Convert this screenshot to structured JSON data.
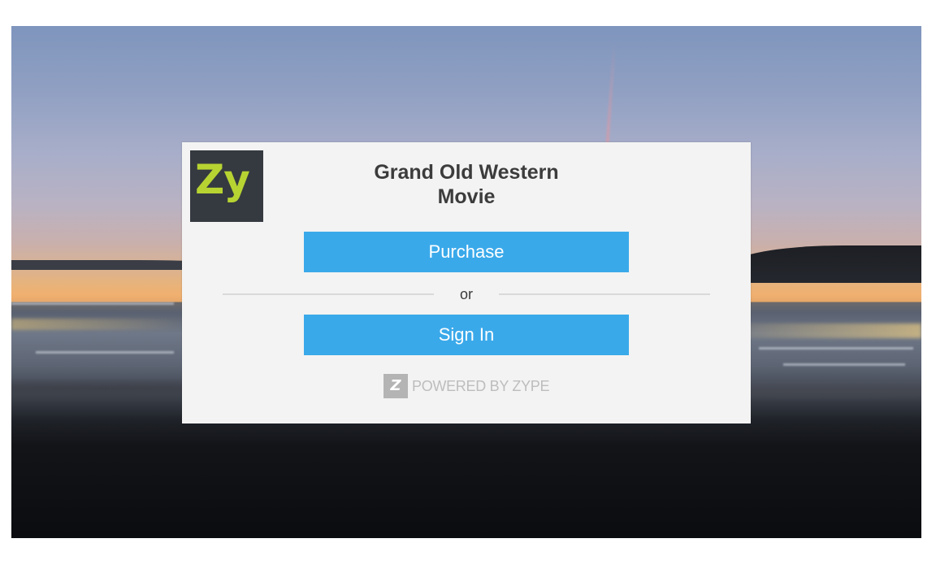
{
  "background": {
    "description_icon": "lake-sunset-background"
  },
  "modal": {
    "logo": {
      "text": "Zy",
      "bg_color": "#353a40",
      "text_color": "#b7d332"
    },
    "title_line1": "Grand Old Western",
    "title_line2": "Movie",
    "purchase_label": "Purchase",
    "divider_label": "or",
    "signin_label": "Sign In",
    "powered_badge": "Z",
    "powered_label": "POWERED BY ZYPE",
    "accent_color": "#3aa9ea"
  }
}
